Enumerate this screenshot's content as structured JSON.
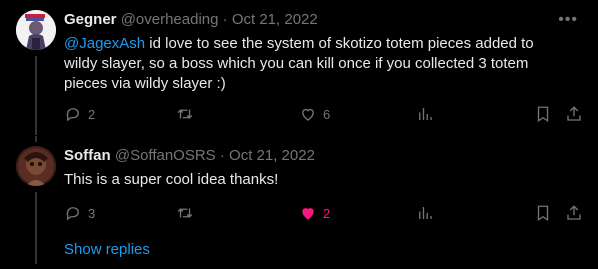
{
  "tweets": [
    {
      "name": "Gegner",
      "handle": "@overheading",
      "separator": "·",
      "date": "Oct 21, 2022",
      "mention": "@JagexAsh",
      "text": " id love to see the system of skotizo totem pieces added to wildy slayer, so a boss which you can kill once if you collected 3 totem pieces via wildy slayer :)",
      "replies": "2",
      "retweets": "",
      "likes": "6",
      "liked": false
    },
    {
      "name": "Soffan",
      "handle": "@SoffanOSRS",
      "separator": "·",
      "date": "Oct 21, 2022",
      "text": "This is a super cool idea thanks!",
      "replies": "3",
      "retweets": "",
      "likes": "2",
      "liked": true
    }
  ],
  "show_replies": "Show replies",
  "colors": {
    "accent": "#1d9bf0",
    "like": "#f91880",
    "muted": "#71767b",
    "text": "#e7e9ea"
  },
  "icons": [
    "more-icon",
    "reply-icon",
    "retweet-icon",
    "like-icon",
    "views-icon",
    "bookmark-icon",
    "share-icon"
  ]
}
